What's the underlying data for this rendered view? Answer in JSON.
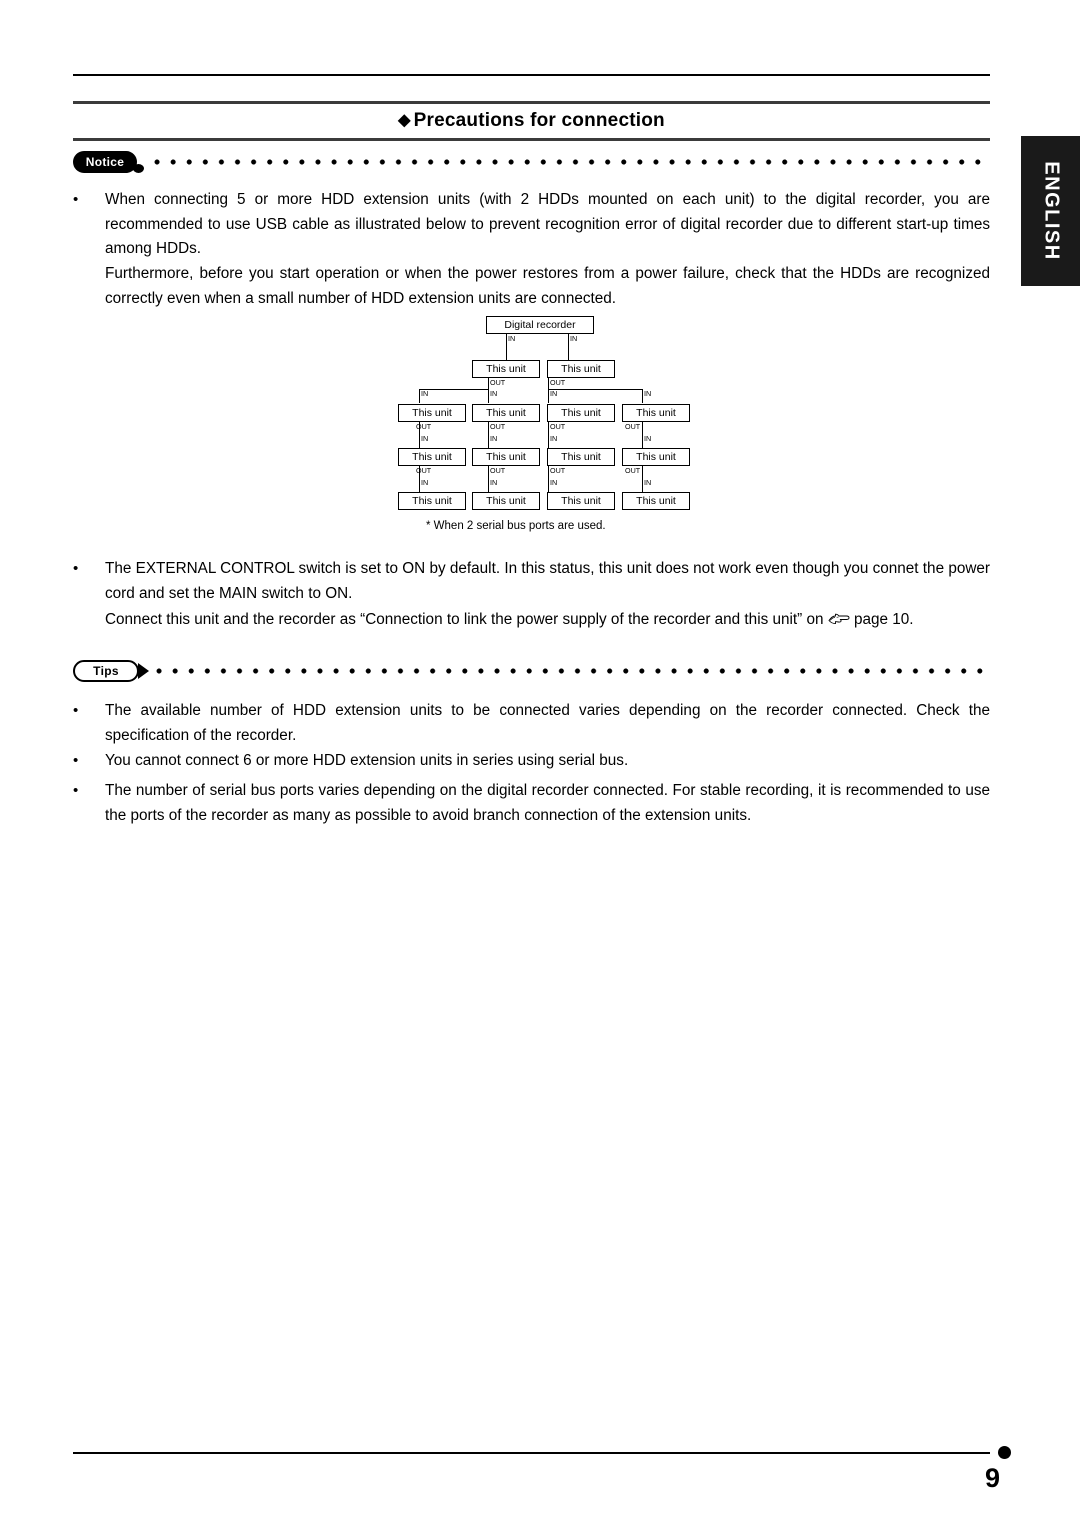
{
  "page": {
    "number": "9",
    "side_tab": "ENGLISH",
    "heading": "Precautions for connection",
    "heading_marker": "◆"
  },
  "notice": {
    "badge": "Notice",
    "bullets": [
      {
        "marker": "•",
        "text": "When connecting 5 or more HDD extension units (with 2 HDDs mounted on each unit) to the digital recorder, you are recommended to use USB cable as illustrated below to prevent recognition error of digital recorder due to different start-up times among HDDs."
      }
    ],
    "paragraph_2": "Furthermore, before you start operation or when the power restores from a power failure, check that the HDDs are recognized correctly even when a small number of HDD extension units are connected.",
    "bullet_2": {
      "marker": "•",
      "text": "The EXTERNAL CONTROL switch is set to ON by default. In this status, this unit does not work even though you connet the power cord and set the MAIN switch to ON."
    },
    "paragraph_3_before": "Connect this unit and the recorder as “Connection to link the power supply of the recorder and this unit” on",
    "paragraph_3_after": "page 10."
  },
  "diagram": {
    "caption": "* When 2 serial bus ports are used.",
    "recorder_label": "Digital recorder",
    "unit_label": "This unit",
    "port_in": "IN",
    "port_out": "OUT",
    "rows": [
      {
        "units": [
          "This unit",
          "This unit"
        ]
      },
      {
        "units": [
          "This unit",
          "This unit",
          "This unit",
          "This unit"
        ]
      },
      {
        "units": [
          "This unit",
          "This unit",
          "This unit",
          "This unit"
        ]
      },
      {
        "units": [
          "This unit",
          "This unit",
          "This unit",
          "This unit"
        ]
      }
    ]
  },
  "tips": {
    "badge": "Tips",
    "bullets": [
      {
        "marker": "•",
        "text": "The available number of HDD extension units to be connected varies depending on the recorder connected. Check the specification of the recorder."
      },
      {
        "marker": "•",
        "text": "You cannot connect 6 or more HDD extension units in series using serial bus."
      },
      {
        "marker": "•",
        "text": "The number of serial bus ports varies depending on the digital recorder connected. For stable recording, it is recommended to use the ports of the recorder as many as possible to avoid branch connection of the extension units."
      }
    ]
  }
}
